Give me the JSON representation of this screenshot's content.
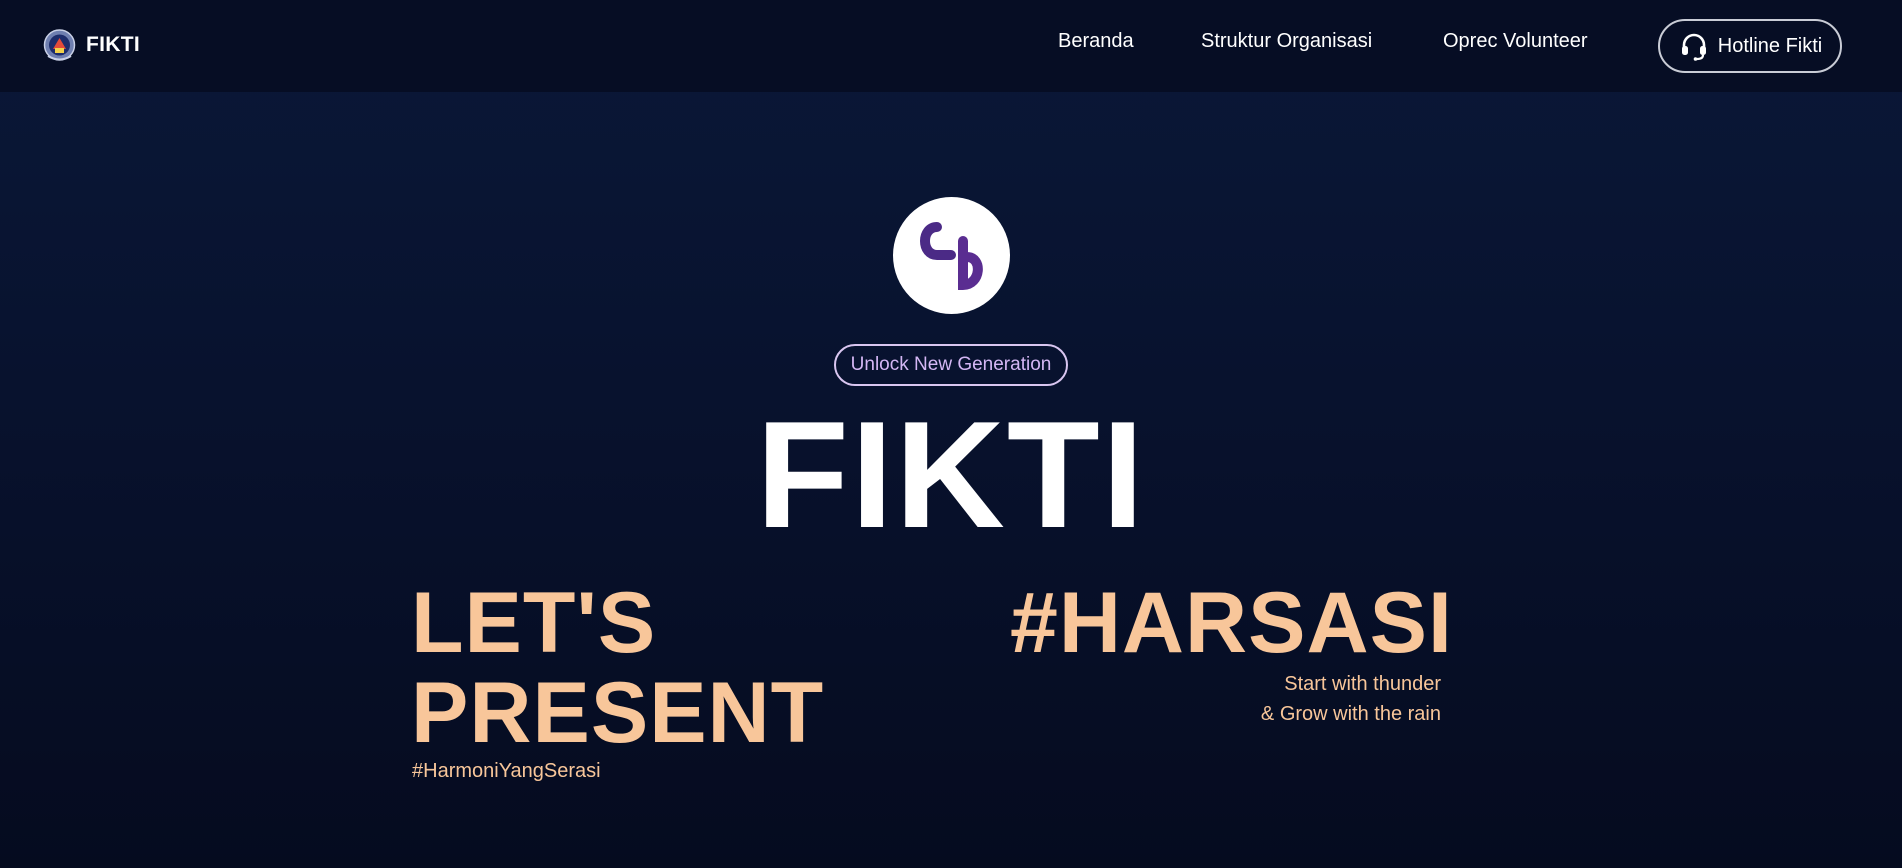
{
  "nav": {
    "brand": "FIKTI",
    "links": [
      "Beranda",
      "Struktur Organisasi",
      "Oprec Volunteer"
    ],
    "hotline_label": "Hotline Fikti"
  },
  "hero": {
    "badge": "Unlock New Generation",
    "title": "FIKTI",
    "left_heading_line1": "LET'S",
    "left_heading_line2": "PRESENT",
    "left_hashtag": "#HarmoniYangSerasi",
    "right_heading": "#HARSASI",
    "tagline_line1": "Start with thunder",
    "tagline_line2": "& Grow with the rain"
  },
  "icons": {
    "brand_logo": "university-crest-icon",
    "hotline": "headset-icon",
    "hero_logo": "harsasi-logo-icon"
  },
  "colors": {
    "background": "#08122e",
    "navbar": "#060d24",
    "accent_peach": "#f8c69a",
    "accent_lavender": "#d4b6f4",
    "logo_purple": "#5a2d91",
    "logo_orange": "#f39b1d"
  }
}
